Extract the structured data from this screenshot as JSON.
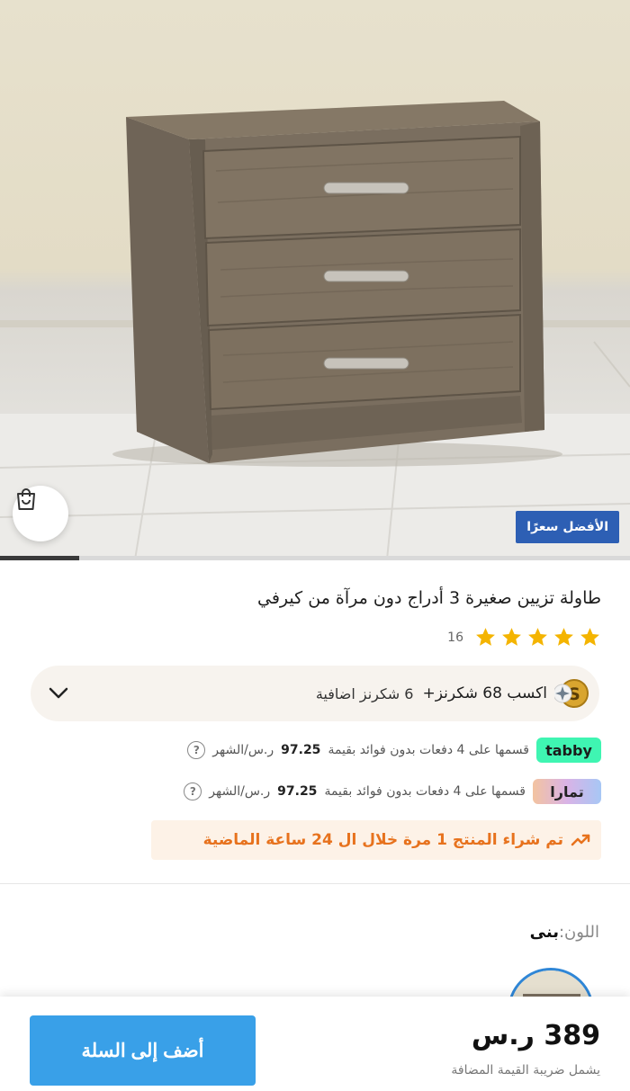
{
  "product": {
    "badge": "الأفضل سعرًا",
    "title": "طاولة تزيين صغيرة 3 أدراج دون مرآة من كيرفي",
    "rating_count": "16",
    "rating_stars": 5,
    "gallery_progress": 0.125
  },
  "points": {
    "earn_text": "اكسب 68 شكرنز+",
    "extra_text": "6 شكرنز اضافية"
  },
  "installments": [
    {
      "provider": "tabby",
      "logo_text": "tabby",
      "text": "قسمها على 4 دفعات بدون فوائد بقيمة",
      "amount": "97.25",
      "unit": "ر.س/الشهر",
      "help": "?"
    },
    {
      "provider": "tamara",
      "logo_text": "تمارا",
      "text": "قسمها على 4 دفعات بدون فوائد بقيمة",
      "amount": "97.25",
      "unit": "ر.س/الشهر",
      "help": "?"
    }
  ],
  "purchase_notice": "تم شراء المنتج 1 مرة خلال ال 24 ساعة الماضية",
  "color": {
    "label": "اللون:",
    "value": "بنى"
  },
  "bottom_bar": {
    "add_to_cart": "أضف إلى السلة",
    "price": "389 ر.س",
    "vat_note": "يشمل ضريبة القيمة المضافة"
  },
  "colors": {
    "accent_blue": "#39a0e8",
    "badge_blue": "#2d5fb4",
    "star": "#f4b400",
    "notice_orange": "#e7721d",
    "tabby_green": "#3ff5b2"
  },
  "icons": [
    "shopping-bag-icon",
    "star-icon",
    "coin-icon",
    "sparkle-icon",
    "chevron-down-icon",
    "trending-up-icon",
    "help-icon"
  ]
}
